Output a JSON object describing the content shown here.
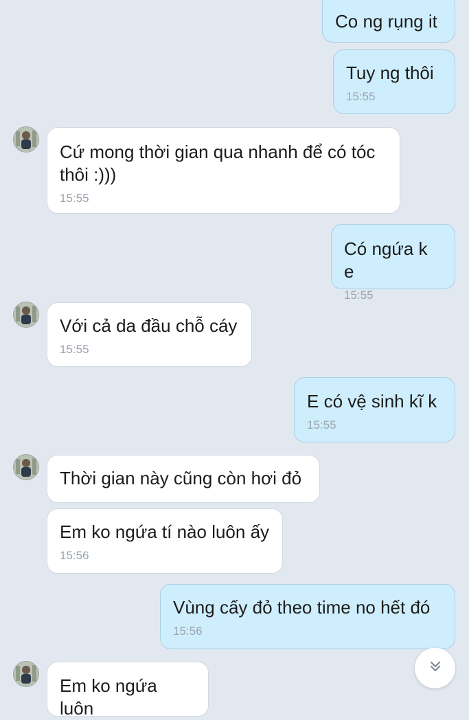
{
  "messages": [
    {
      "text": "Co ng rụng it",
      "time": ""
    },
    {
      "text": "Tuy ng thôi",
      "time": "15:55"
    },
    {
      "text": "Cứ mong thời gian qua nhanh để có tóc\nthôi :)))",
      "time": "15:55"
    },
    {
      "text": "Có ngứa k e",
      "time": "15:55"
    },
    {
      "text": "Với cả da đầu chỗ cáy",
      "time": "15:55"
    },
    {
      "text": "E có vệ sinh kĩ k",
      "time": "15:55"
    },
    {
      "text": "Thời gian này cũng còn hơi đỏ",
      "time": ""
    },
    {
      "text": "Em ko ngứa tí nào luôn ấy",
      "time": "15:56"
    },
    {
      "text": "Vùng cấy đỏ theo time no hết đó",
      "time": "15:56"
    },
    {
      "text": "Em ko ngứa luôn",
      "time": ""
    }
  ],
  "icons": {
    "avatar": "contact-avatar",
    "scroll": "double-chevron-down-icon"
  },
  "colors": {
    "background": "#e2e8f0",
    "incoming_bubble": "#ffffff",
    "outgoing_bubble": "#cfeefd",
    "timestamp": "#9aa3ad"
  }
}
